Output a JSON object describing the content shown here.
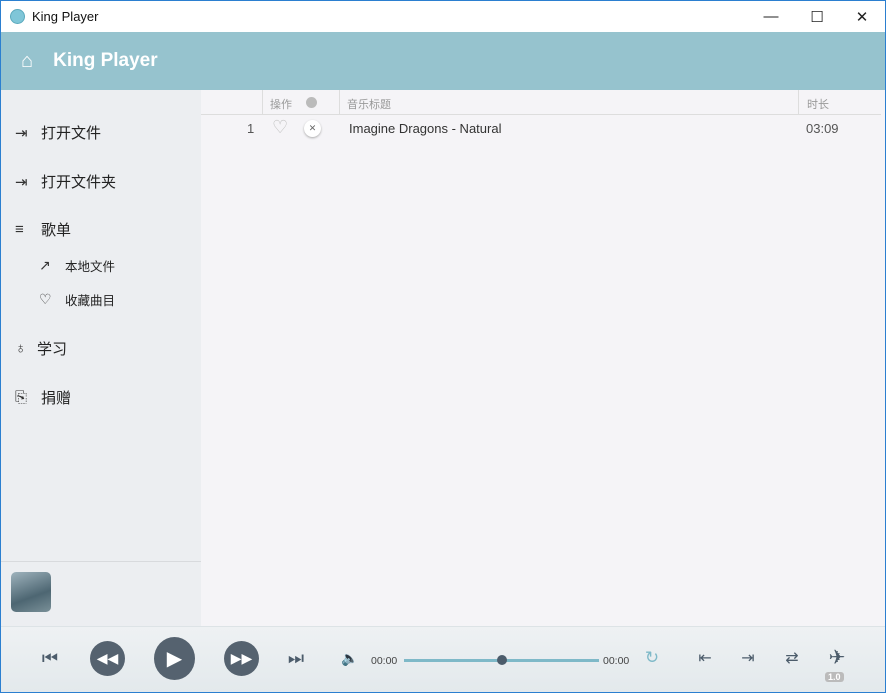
{
  "window": {
    "title": "King Player",
    "minimize": "—",
    "maximize": "☐",
    "close": "✕"
  },
  "header": {
    "title": "King Player"
  },
  "sidebar": {
    "items": [
      {
        "label": "打开文件"
      },
      {
        "label": "打开文件夹"
      },
      {
        "label": "歌单"
      },
      {
        "label": "本地文件"
      },
      {
        "label": "收藏曲目"
      },
      {
        "label": "学习"
      },
      {
        "label": "捐赠"
      }
    ]
  },
  "table": {
    "headers": {
      "action": "操作",
      "title": "音乐标题",
      "duration": "时长"
    },
    "rows": [
      {
        "index": "1",
        "title": "Imagine Dragons - Natural",
        "duration": "03:09"
      }
    ]
  },
  "player": {
    "current_time": "00:00",
    "total_time": "00:00",
    "progress": 0.5,
    "speed": "1.0"
  }
}
